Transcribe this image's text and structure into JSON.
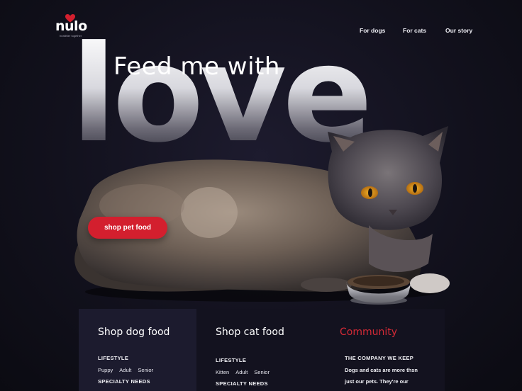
{
  "brand": {
    "name": "nulo",
    "tagline": "healthier together"
  },
  "nav": {
    "items": [
      "For dogs",
      "For cats",
      "Our story"
    ]
  },
  "hero": {
    "line1": "Feed me with",
    "line2": "love",
    "cta": "shop pet food"
  },
  "cards": [
    {
      "title": "Shop dog food",
      "section1": "LIFESTYLE",
      "links": [
        "Puppy",
        "Adult",
        "Senior"
      ],
      "section2": "SPECIALTY NEEDS"
    },
    {
      "title": "Shop cat food",
      "section1": "LIFESTYLE",
      "links": [
        "Kitten",
        "Adult",
        "Senior"
      ],
      "section2": "SPECIALTY NEEDS"
    },
    {
      "title": "Community",
      "section1": "THE COMPANY WE KEEP",
      "lines": [
        "Dogs and cats are more thsn",
        "just our pets. They're our"
      ]
    }
  ],
  "colors": {
    "accent": "#d31f2e",
    "background": "#12111d",
    "card_highlight": "#1c1b2e"
  }
}
